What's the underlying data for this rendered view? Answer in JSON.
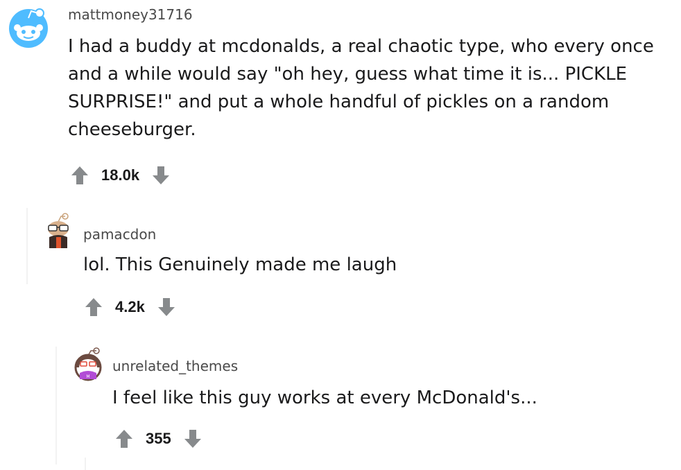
{
  "comments": [
    {
      "username": "mattmoney31716",
      "body": "I had a buddy at mcdonalds, a real chaotic type, who every once and a while would say \"oh hey, guess what time it is... PICKLE SURPRISE!\" and put a whole handful of pickles on a random cheeseburger.",
      "score": "18.0k",
      "avatar_icon": "snoo-default-blue-icon"
    },
    {
      "username": "pamacdon",
      "body": "lol. This Genuinely made me laugh",
      "score": "4.2k",
      "avatar_icon": "snoo-avatar-glasses-icon"
    },
    {
      "username": "unrelated_themes",
      "body": "I feel like this guy works at every McDonald's...",
      "score": "355",
      "avatar_icon": "snoo-avatar-purple-icon"
    }
  ],
  "colors": {
    "arrow": "#878a8c",
    "username": "#4a4a4a",
    "text": "#1a1a1b",
    "snoo_blue": "#4fbcff"
  },
  "icons": {
    "upvote": "upvote-arrow-icon",
    "downvote": "downvote-arrow-icon"
  }
}
